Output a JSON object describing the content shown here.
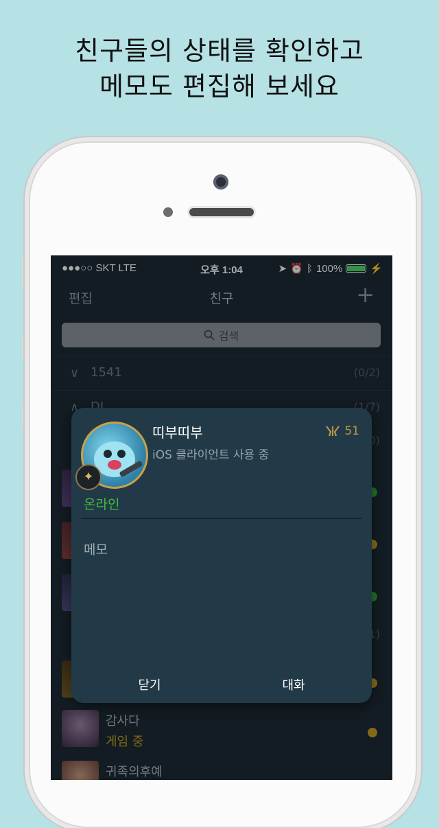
{
  "headline": {
    "line1": "친구들의 상태를 확인하고",
    "line2": "메모도 편집해 보세요"
  },
  "status_bar": {
    "carrier": "●●●○○ SKT   LTE",
    "time": "오후 1:04",
    "battery": "100%",
    "battery_level": 1.0,
    "icons": [
      "location-arrow-icon",
      "alarm-icon",
      "bluetooth-icon",
      "charging-bolt-icon"
    ]
  },
  "nav": {
    "edit": "편집",
    "title": "친구",
    "add_icon": "+"
  },
  "search": {
    "placeholder": "검색"
  },
  "groups": [
    {
      "chevron": "∨",
      "name": "1541",
      "count": "(0/2)"
    },
    {
      "chevron": "∧",
      "name": "DJ",
      "count": "(1/7)"
    },
    {
      "chevron": "",
      "name": "",
      "count": "0)"
    },
    {
      "chevron": "",
      "name": "",
      "count": "1)"
    }
  ],
  "friends_visible": [
    {
      "name": "감사다",
      "status": "게임 중",
      "status_color": "#c49a1f"
    },
    {
      "name": "귀족의후예",
      "status": "",
      "status_color": "#c49a1f"
    }
  ],
  "dot_colors": {
    "online": "#2ea32e",
    "in_game": "#c49a1f"
  },
  "modal": {
    "name": "띠부띠부",
    "client": "iOS 클라이언트 사용 중",
    "level": "51",
    "status": "온라인",
    "memo_label": "메모",
    "close": "닫기",
    "chat": "대화"
  }
}
